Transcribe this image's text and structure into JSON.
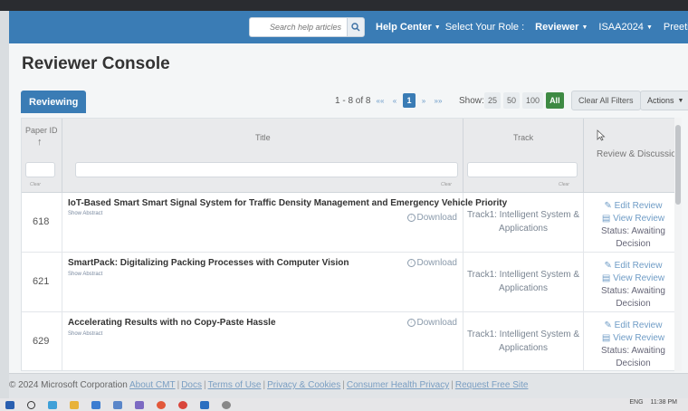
{
  "navbar": {
    "search_placeholder": "Search help articles",
    "help_center": "Help Center",
    "select_role_label": "Select Your Role :",
    "role": "Reviewer",
    "conference": "ISAA2024",
    "user": "Preeti Patil"
  },
  "page": {
    "title": "Reviewer Console"
  },
  "toolbar": {
    "tab": "Reviewing",
    "range": "1 - 8 of 8",
    "pager": {
      "first": "««",
      "prev": "«",
      "current": "1",
      "next": "»",
      "last": "»»"
    },
    "show_label": "Show:",
    "show_options": [
      "25",
      "50",
      "100",
      "All"
    ],
    "show_selected": "All",
    "clear_filters": "Clear All Filters",
    "actions": "Actions"
  },
  "table": {
    "headers": {
      "paper_id": "Paper ID",
      "sort_icon": "↑",
      "title": "Title",
      "track": "Track",
      "review": "Review & Discussion"
    },
    "clear_label": "Clear",
    "rows": [
      {
        "id": "618",
        "title": "IoT-Based Smart Smart Signal System for Traffic Density Management and Emergency Vehicle Priority",
        "show_abstract": "Show Abstract",
        "download": "Download",
        "track_line1": "Track1: Intelligent System &",
        "track_line2": "Applications",
        "edit_review": "Edit Review",
        "view_review": "View Review",
        "status": "Status: Awaiting Decision"
      },
      {
        "id": "621",
        "title": "SmartPack: Digitalizing Packing Processes with Computer Vision",
        "show_abstract": "Show Abstract",
        "download": "Download",
        "track_line1": "Track1: Intelligent System &",
        "track_line2": "Applications",
        "edit_review": "Edit Review",
        "view_review": "View Review",
        "status": "Status: Awaiting Decision"
      },
      {
        "id": "629",
        "title": "Accelerating Results with no Copy-Paste Hassle",
        "show_abstract": "Show Abstract",
        "download": "Download",
        "track_line1": "Track1: Intelligent System &",
        "track_line2": "Applications",
        "edit_review": "Edit Review",
        "view_review": "View Review",
        "status": "Status: Awaiting Decision"
      }
    ]
  },
  "footer": {
    "copyright": "© 2024 Microsoft Corporation",
    "links": [
      "About CMT",
      "Docs",
      "Terms of Use",
      "Privacy & Cookies",
      "Consumer Health Privacy",
      "Request Free Site"
    ]
  },
  "taskbar": {
    "language": "ENG",
    "time": "11:38 PM"
  },
  "colors": {
    "navbar": "#3a7cb5",
    "accent_green": "#3e8a43",
    "link": "#6f9cc6"
  }
}
